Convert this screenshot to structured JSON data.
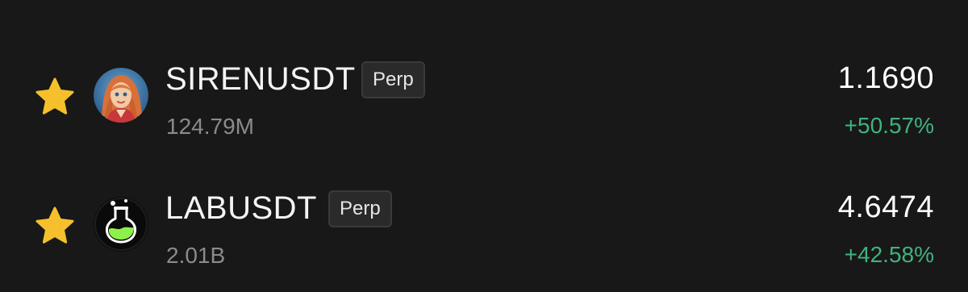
{
  "rows": [
    {
      "symbol": "SIRENUSDT",
      "badge": "Perp",
      "volume": "124.79M",
      "price": "1.1690",
      "change": "+50.57%",
      "favorited": true,
      "icon": "siren-avatar-icon"
    },
    {
      "symbol": "LABUSDT",
      "badge": "Perp",
      "volume": "2.01B",
      "price": "4.6474",
      "change": "+42.58%",
      "favorited": true,
      "icon": "lab-flask-icon"
    }
  ],
  "colors": {
    "background": "#181818",
    "star": "#f5c02b",
    "positive": "#3fb37f",
    "muted_text": "#8b8b8b",
    "badge_bg": "#2a2a2a"
  }
}
